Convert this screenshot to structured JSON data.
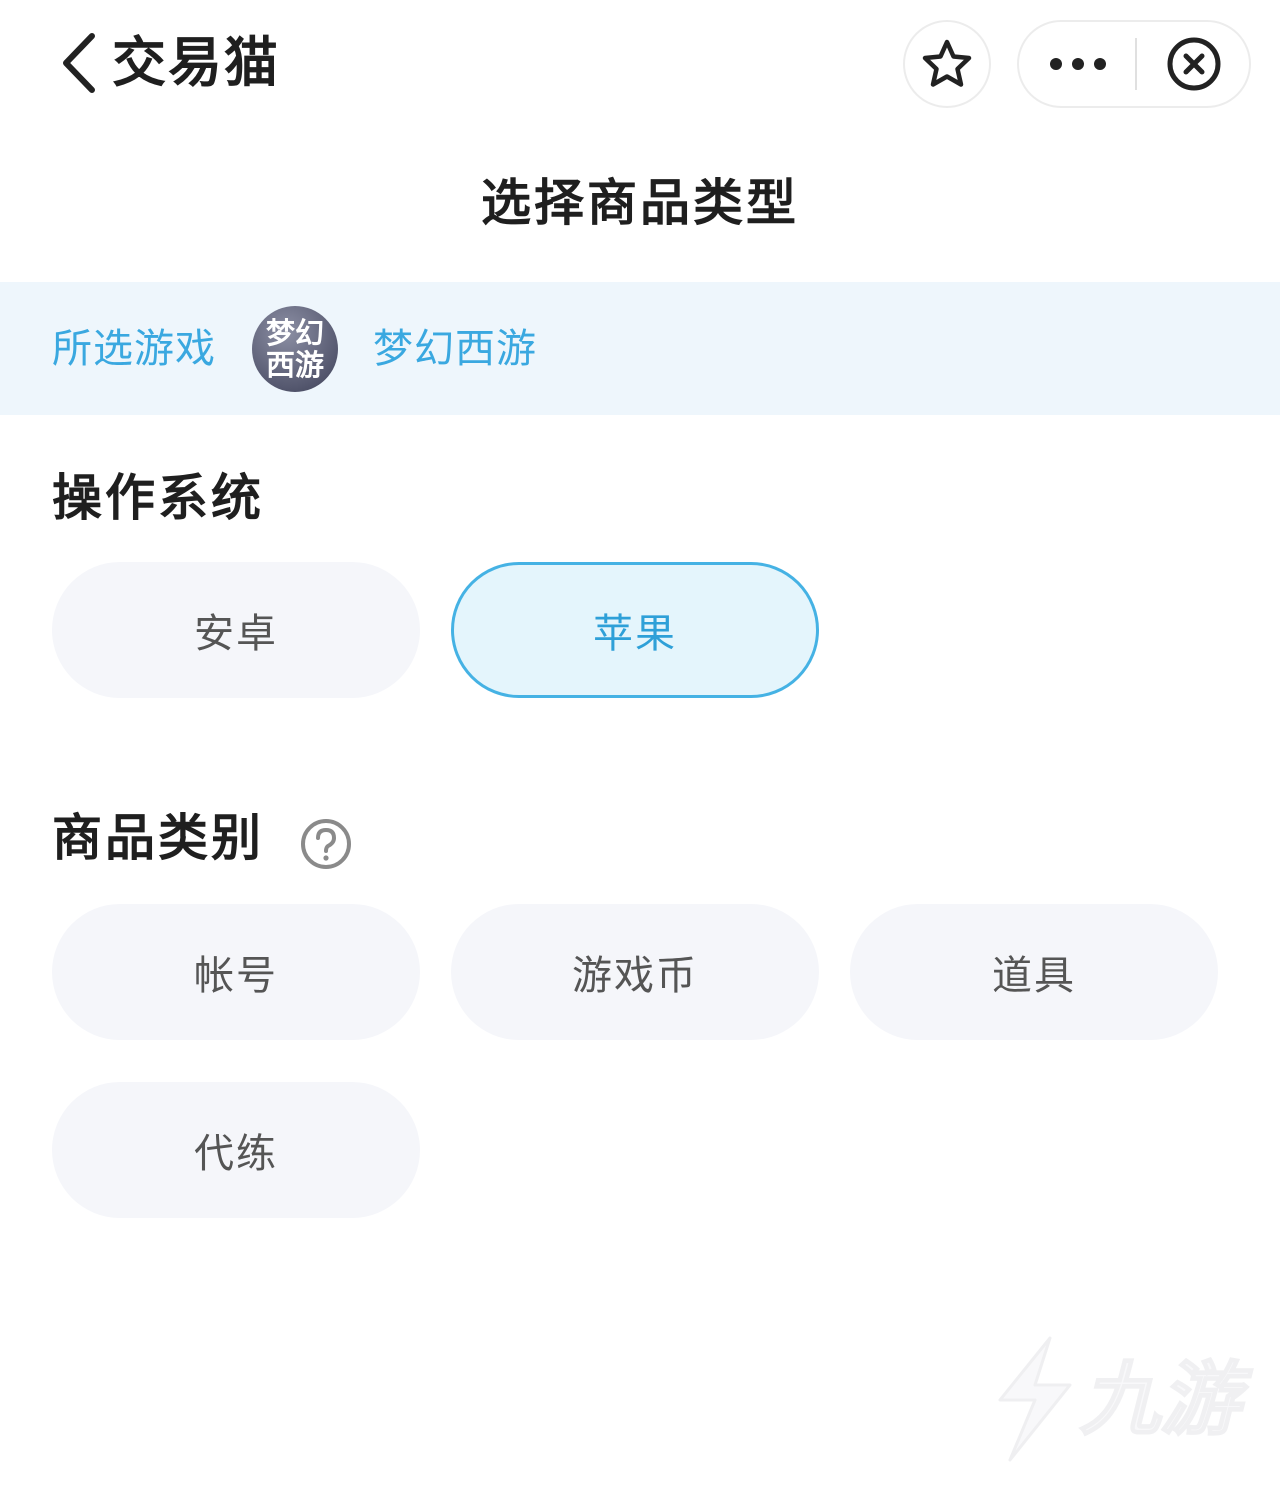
{
  "topbar": {
    "app_title": "交易猫"
  },
  "page_title": "选择商品类型",
  "game_banner": {
    "label": "所选游戏",
    "logo_line1": "梦幻",
    "logo_line2": "西游",
    "game_name": "梦幻西游"
  },
  "os_section": {
    "title": "操作系统",
    "options": [
      "安卓",
      "苹果"
    ],
    "selected": "苹果"
  },
  "category_section": {
    "title": "商品类别",
    "options": [
      "帐号",
      "游戏币",
      "道具",
      "代练"
    ]
  },
  "watermark": {
    "text": "九游"
  },
  "colors": {
    "accent": "#3aa8e0",
    "selected_border": "#45b2e4",
    "selected_bg": "#e4f5fc",
    "chip_bg": "#f5f6fa",
    "banner_bg": "#eef6fc"
  },
  "icons": [
    "back-arrow-icon",
    "star-icon",
    "more-dots-icon",
    "close-circle-icon",
    "help-question-icon"
  ]
}
